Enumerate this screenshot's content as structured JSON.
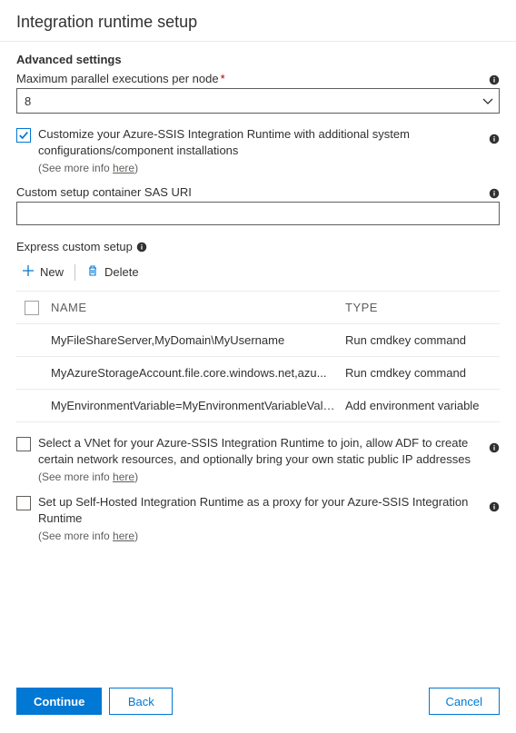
{
  "header": {
    "title": "Integration runtime setup"
  },
  "advanced": {
    "title": "Advanced settings",
    "maxParallel": {
      "label": "Maximum parallel executions per node",
      "required": "*",
      "value": "8"
    },
    "customize": {
      "text": "Customize your Azure-SSIS Integration Runtime with additional system configurations/component installations",
      "moreText": "(See more info ",
      "moreLink": "here",
      "moreClose": ")",
      "checked": true
    },
    "sasUri": {
      "label": "Custom setup container SAS URI",
      "value": ""
    },
    "express": {
      "label": "Express custom setup",
      "newLabel": "New",
      "deleteLabel": "Delete",
      "cols": {
        "name": "NAME",
        "type": "TYPE"
      },
      "rows": [
        {
          "name": "MyFileShareServer,MyDomain\\MyUsername",
          "type": "Run cmdkey command"
        },
        {
          "name": "MyAzureStorageAccount.file.core.windows.net,azu...",
          "type": "Run cmdkey command"
        },
        {
          "name": "MyEnvironmentVariable=MyEnvironmentVariableValu...",
          "type": "Add environment variable"
        }
      ]
    },
    "vnet": {
      "text": "Select a VNet for your Azure-SSIS Integration Runtime to join, allow ADF to create certain network resources, and optionally bring your own static public IP addresses",
      "moreText": "(See more info ",
      "moreLink": "here",
      "moreClose": ")"
    },
    "proxy": {
      "text": "Set up Self-Hosted Integration Runtime as a proxy for your Azure-SSIS Integration Runtime",
      "moreText": "(See more info ",
      "moreLink": "here",
      "moreClose": ")"
    }
  },
  "footer": {
    "continue": "Continue",
    "back": "Back",
    "cancel": "Cancel"
  }
}
